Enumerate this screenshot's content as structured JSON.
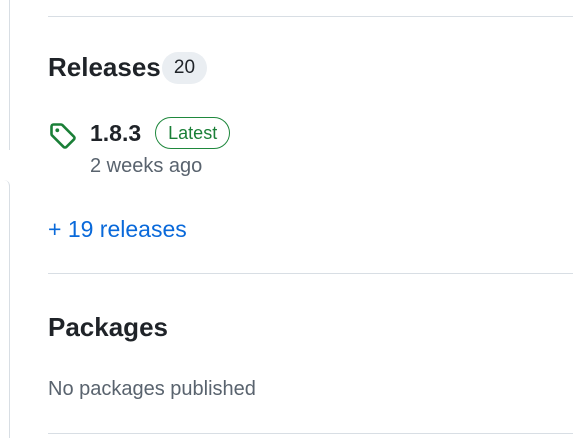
{
  "releases": {
    "title": "Releases",
    "count": "20",
    "latest": {
      "icon": "tag-icon",
      "version": "1.8.3",
      "badge": "Latest",
      "date": "2 weeks ago"
    },
    "more_link": "+ 19 releases"
  },
  "packages": {
    "title": "Packages",
    "empty_text": "No packages published"
  },
  "colors": {
    "link": "#0969da",
    "success": "#1a7f37",
    "muted": "#59636e",
    "border": "#d8dee4"
  }
}
